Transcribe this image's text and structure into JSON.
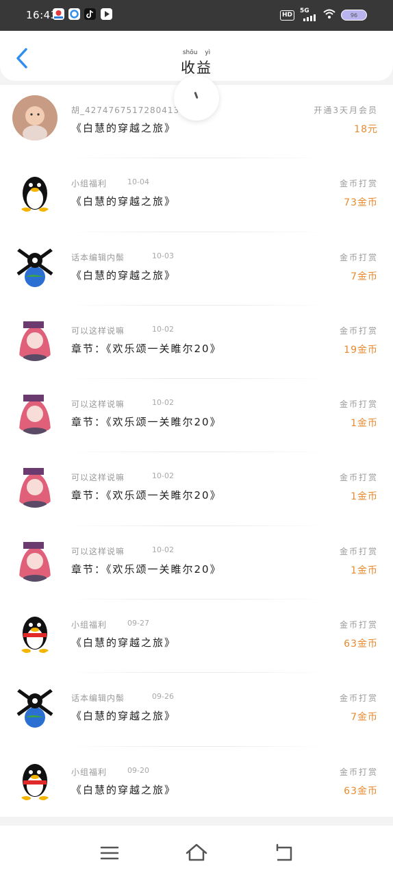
{
  "status_bar": {
    "time": "16:43",
    "hd": "HD",
    "network": "5G",
    "battery": "96",
    "app_icons": [
      "map-icon",
      "browser-icon",
      "tiktok-icon",
      "video-icon"
    ]
  },
  "header": {
    "title": "收益",
    "title_pinyin": "shōu yì",
    "back_icon": "chevron-left-icon"
  },
  "colors": {
    "accent": "#e88a2e",
    "link_blue": "#2f8ef0",
    "muted_text": "#9a9a9a"
  },
  "rows": [
    {
      "avatar": "baby-photo",
      "name": "胡_4274767517280413704",
      "date": "",
      "content": "《白慧的穿越之旅》",
      "type": "开通3天月会员",
      "amount": "18元"
    },
    {
      "avatar": "qq-penguin",
      "name": "小组福利",
      "date": "10-04",
      "content": "《白慧的穿越之旅》",
      "type": "金币打赏",
      "amount": "73金币"
    },
    {
      "avatar": "dark-character",
      "name": "话本编辑内鬃",
      "date": "10-03",
      "content": "《白慧的穿越之旅》",
      "type": "金币打赏",
      "amount": "7金币"
    },
    {
      "avatar": "anime-girl",
      "name": "可以这样说嘛",
      "date": "10-02",
      "content": "章节：《欢乐颂一关睢尔20》",
      "type": "金币打赏",
      "amount": "19金币"
    },
    {
      "avatar": "anime-girl",
      "name": "可以这样说嘛",
      "date": "10-02",
      "content": "章节：《欢乐颂一关睢尔20》",
      "type": "金币打赏",
      "amount": "1金币"
    },
    {
      "avatar": "anime-girl",
      "name": "可以这样说嘛",
      "date": "10-02",
      "content": "章节：《欢乐颂一关睢尔20》",
      "type": "金币打赏",
      "amount": "1金币"
    },
    {
      "avatar": "anime-girl",
      "name": "可以这样说嘛",
      "date": "10-02",
      "content": "章节：《欢乐颂一关睢尔20》",
      "type": "金币打赏",
      "amount": "1金币"
    },
    {
      "avatar": "qq-penguin",
      "name": "小组福利",
      "date": "09-27",
      "content": "《白慧的穿越之旅》",
      "type": "金币打赏",
      "amount": "63金币"
    },
    {
      "avatar": "dark-character",
      "name": "话本编辑内鬃",
      "date": "09-26",
      "content": "《白慧的穿越之旅》",
      "type": "金币打赏",
      "amount": "7金币"
    },
    {
      "avatar": "qq-penguin",
      "name": "小组福利",
      "date": "09-20",
      "content": "《白慧的穿越之旅》",
      "type": "金币打赏",
      "amount": "63金币"
    }
  ],
  "nav": {
    "menu_icon": "menu-icon",
    "home_icon": "home-icon",
    "back_icon": "back-icon"
  }
}
